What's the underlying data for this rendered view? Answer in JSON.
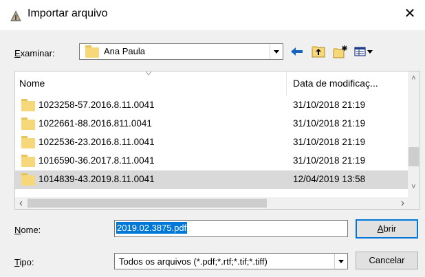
{
  "window": {
    "title": "Importar arquivo",
    "close_glyph": "✕",
    "icon": "import-app-icon"
  },
  "lookin": {
    "label": "Examinar:",
    "label_access_key": "E",
    "label_rest": "xaminar:",
    "value": "Ana Paula",
    "icon": "folder-icon"
  },
  "toolbar": {
    "back_icon": "back-arrow-icon",
    "up_icon": "up-folder-icon",
    "new_folder_icon": "new-folder-icon",
    "view_menu_icon": "view-menu-icon"
  },
  "file_list": {
    "columns": {
      "name": "Nome",
      "date": "Data de modificaç..."
    },
    "rows": [
      {
        "name": "1023258-57.2016.8.11.0041",
        "date": "31/10/2018 21:19",
        "selected": false
      },
      {
        "name": "1022661-88.2016.811.0041",
        "date": "31/10/2018 21:19",
        "selected": false
      },
      {
        "name": "1022536-23.2016.8.11.0041",
        "date": "31/10/2018 21:19",
        "selected": false
      },
      {
        "name": "1016590-36.2017.8.11.0041",
        "date": "31/10/2018 21:19",
        "selected": false
      },
      {
        "name": "1014839-43.2019.8.11.0041",
        "date": "12/04/2019 13:58",
        "selected": true
      }
    ],
    "scroll_left": "‹",
    "scroll_right": "›",
    "scroll_up": "˄",
    "scroll_down": "˅"
  },
  "filename": {
    "label": "Nome:",
    "label_access_key": "N",
    "label_rest": "ome:",
    "value": "2019.02.3875.pdf"
  },
  "filetype": {
    "label": "Tipo:",
    "label_access_key": "T",
    "label_rest": "ipo:",
    "value": "Todos os arquivos (*.pdf;*.rtf;*.tif;*.tiff)"
  },
  "buttons": {
    "open": "Abrir",
    "open_access_key": "A",
    "open_rest": "brir",
    "cancel": "Cancelar"
  },
  "colors": {
    "selection": "#0078d7",
    "selected_row": "#d9d9d9"
  }
}
